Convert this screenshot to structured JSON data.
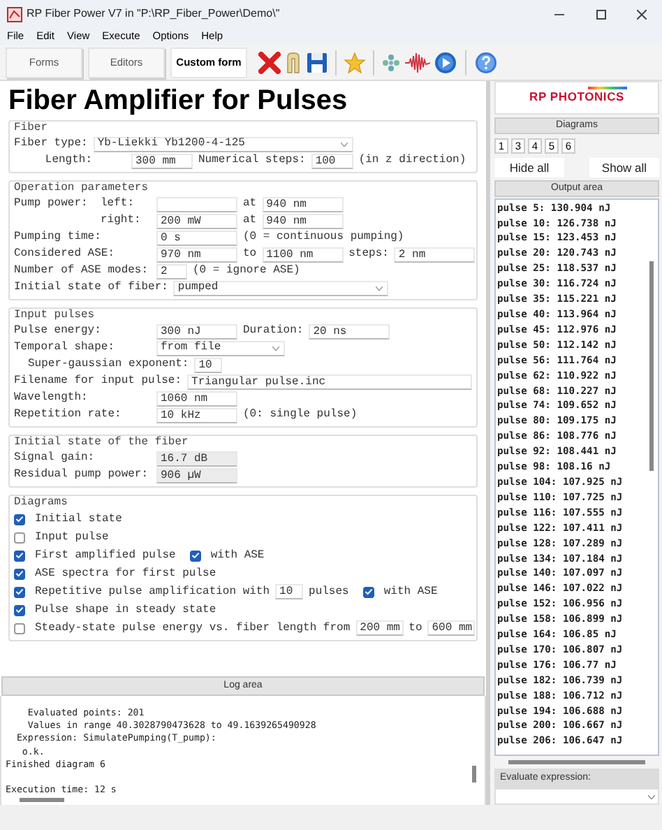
{
  "window": {
    "title": "RP Fiber Power V7 in \"P:\\RP_Fiber_Power\\Demo\\\""
  },
  "menu": [
    {
      "label": "File"
    },
    {
      "label": "Edit"
    },
    {
      "label": "View"
    },
    {
      "label": "Execute"
    },
    {
      "label": "Options"
    },
    {
      "label": "Help"
    }
  ],
  "toolbar": {
    "tabs": [
      {
        "label": "Forms",
        "selected": false
      },
      {
        "label": "Editors",
        "selected": false
      },
      {
        "label": "Custom form",
        "selected": true
      }
    ]
  },
  "form": {
    "heading": "Fiber Amplifier for Pulses",
    "groups": [
      {
        "title": "Fiber",
        "rows": [
          {
            "items": [
              {
                "kind": "text",
                "text": "Fiber type:"
              },
              {
                "kind": "dropdown_fiber",
                "value": "Yb-Liekki Yb1200-4-125"
              }
            ]
          },
          {
            "items": [
              {
                "kind": "lead_right",
                "text": "Length:"
              },
              {
                "kind": "field_len",
                "value": "300 mm"
              },
              {
                "kind": "text",
                "text": "Numerical steps:"
              },
              {
                "kind": "field_num",
                "value": "100"
              },
              {
                "kind": "text",
                "text": "(in z direction)"
              }
            ]
          }
        ]
      },
      {
        "title": "Operation parameters",
        "rows": [
          {
            "items": [
              {
                "kind": "pre",
                "text": "Pump power:"
              },
              {
                "kind": "sub",
                "text": "left:"
              },
              {
                "kind": "field"
              },
              {
                "kind": "text",
                "text": "at"
              },
              {
                "kind": "field",
                "value": "940 nm"
              }
            ]
          },
          {
            "items": [
              {
                "kind": "subr",
                "text": "right:"
              },
              {
                "kind": "field",
                "value": "200 mW"
              },
              {
                "kind": "text",
                "text": "at"
              },
              {
                "kind": "field",
                "value": "940 nm"
              }
            ]
          },
          {
            "items": [
              {
                "kind": "lead",
                "text": "Pumping time:"
              },
              {
                "kind": "field",
                "value": "0 s"
              },
              {
                "kind": "text",
                "text": "(0 = continuous pumping)"
              }
            ]
          },
          {
            "items": [
              {
                "kind": "lead",
                "text": "Considered ASE:"
              },
              {
                "kind": "field",
                "value": "970 nm"
              },
              {
                "kind": "text",
                "text": "to"
              },
              {
                "kind": "field",
                "value": "1100 nm"
              },
              {
                "kind": "text",
                "text": "steps:"
              },
              {
                "kind": "field",
                "value": "2 nm"
              }
            ]
          },
          {
            "items": [
              {
                "kind": "lead",
                "text": "Number of ASE modes:"
              },
              {
                "kind": "field_short",
                "value": "2"
              },
              {
                "kind": "text",
                "text": "(0 = ignore ASE)"
              }
            ]
          },
          {
            "items": [
              {
                "kind": "text",
                "text": "Initial state of fiber:"
              },
              {
                "kind": "dropdown_wide",
                "value": "pumped"
              }
            ]
          }
        ]
      },
      {
        "title": "Input pulses",
        "rows": [
          {
            "items": [
              {
                "kind": "lead",
                "text": "Pulse energy:"
              },
              {
                "kind": "field",
                "value": "300 nJ"
              },
              {
                "kind": "text",
                "text": "Duration:"
              },
              {
                "kind": "field",
                "value": "20 ns"
              }
            ]
          },
          {
            "items": [
              {
                "kind": "lead",
                "text": "Temporal shape:"
              },
              {
                "kind": "dropdown",
                "value": "from file"
              }
            ]
          },
          {
            "items": [
              {
                "kind": "indented",
                "text": "Super-gaussian exponent:"
              },
              {
                "kind": "field_tiny",
                "value": "10"
              }
            ]
          },
          {
            "items": [
              {
                "kind": "text",
                "text": "Filename for input pulse:"
              },
              {
                "kind": "field_wide",
                "value": "Triangular pulse.inc"
              }
            ]
          },
          {
            "items": [
              {
                "kind": "lead",
                "text": "Wavelength:"
              },
              {
                "kind": "field",
                "value": "1060 nm"
              }
            ]
          },
          {
            "items": [
              {
                "kind": "lead",
                "text": "Repetition rate:"
              },
              {
                "kind": "field",
                "value": "10 kHz"
              },
              {
                "kind": "text",
                "text": "(0: single pulse)"
              }
            ]
          }
        ]
      },
      {
        "title": "Initial state of the fiber",
        "rows": [
          {
            "items": [
              {
                "kind": "lead",
                "text": "Signal gain:"
              },
              {
                "kind": "readonly",
                "value": "16.7 dB"
              }
            ]
          },
          {
            "items": [
              {
                "kind": "lead",
                "text": "Residual pump power:"
              },
              {
                "kind": "readonly",
                "value": "906 µW"
              }
            ]
          }
        ]
      },
      {
        "title": "Diagrams",
        "rows": [
          {
            "items": [
              {
                "kind": "checkbox",
                "label": "Initial state",
                "checked": true
              }
            ]
          },
          {
            "items": [
              {
                "kind": "checkbox",
                "label": "Input pulse",
                "checked": false
              }
            ]
          },
          {
            "items": [
              {
                "kind": "checkbox",
                "label": "First amplified pulse",
                "checked": true
              },
              {
                "kind": "checkbox",
                "label": "with ASE",
                "checked": true
              }
            ]
          },
          {
            "items": [
              {
                "kind": "checkbox",
                "label": "ASE spectra for first pulse",
                "checked": true
              }
            ]
          },
          {
            "items": [
              {
                "kind": "checkbox",
                "label": "Repetitive pulse amplification with",
                "checked": true
              },
              {
                "kind": "field_tiny",
                "value": "10"
              },
              {
                "kind": "text",
                "text": "pulses"
              },
              {
                "kind": "checkbox",
                "label": "with ASE",
                "checked": true
              }
            ]
          },
          {
            "items": [
              {
                "kind": "checkbox",
                "label": "Pulse shape in steady state",
                "checked": true
              }
            ]
          },
          {
            "items": [
              {
                "kind": "checkbox",
                "label": "Steady-state pulse energy vs. fiber length from",
                "checked": false
              },
              {
                "kind": "field_small",
                "value": "200 mm"
              },
              {
                "kind": "text",
                "text": "to"
              },
              {
                "kind": "field_small",
                "value": "600 mm"
              }
            ]
          }
        ]
      }
    ]
  },
  "log": {
    "header": "Log area",
    "blocks": [
      [
        "    Evaluated points: 201",
        "    Values in range 40.3028790473628 to 49.1639265490928",
        "  Expression: SimulatePumping(T_pump):",
        "   o.k.",
        "Finished diagram 6"
      ],
      [
        "Execution time: 12 s"
      ]
    ]
  },
  "side": {
    "logo": "RP PHOTONICS",
    "diagrams_header": "Diagrams",
    "diagram_numbers": [
      "1",
      "3",
      "4",
      "5",
      "6"
    ],
    "buttons": [
      "Hide all",
      "Show all"
    ],
    "output_header": "Output area",
    "output_lines": [
      "pulse 5: 130.904 nJ",
      "pulse 10: 126.738 nJ",
      "pulse 15: 123.453 nJ",
      "pulse 20: 120.743 nJ",
      "pulse 25: 118.537 nJ",
      "pulse 30: 116.724 nJ",
      "pulse 35: 115.221 nJ",
      "pulse 40: 113.964 nJ",
      "pulse 45: 112.976 nJ",
      "pulse 50: 112.142 nJ",
      "pulse 56: 111.764 nJ",
      "pulse 62: 110.922 nJ",
      "pulse 68: 110.227 nJ",
      "pulse 74: 109.652 nJ",
      "pulse 80: 109.175 nJ",
      "pulse 86: 108.776 nJ",
      "pulse 92: 108.441 nJ",
      "pulse 98: 108.16 nJ",
      "pulse 104: 107.925 nJ",
      "pulse 110: 107.725 nJ",
      "pulse 116: 107.555 nJ",
      "pulse 122: 107.411 nJ",
      "pulse 128: 107.289 nJ",
      "pulse 134: 107.184 nJ",
      "pulse 140: 107.097 nJ",
      "pulse 146: 107.022 nJ",
      "pulse 152: 106.956 nJ",
      "pulse 158: 106.899 nJ",
      "pulse 164: 106.85 nJ",
      "pulse 170: 106.807 nJ",
      "pulse 176: 106.77 nJ",
      "pulse 182: 106.739 nJ",
      "pulse 188: 106.712 nJ",
      "pulse 194: 106.688 nJ",
      "pulse 200: 106.667 nJ",
      "pulse 206: 106.647 nJ"
    ],
    "evaluate_label": "Evaluate expression:"
  }
}
